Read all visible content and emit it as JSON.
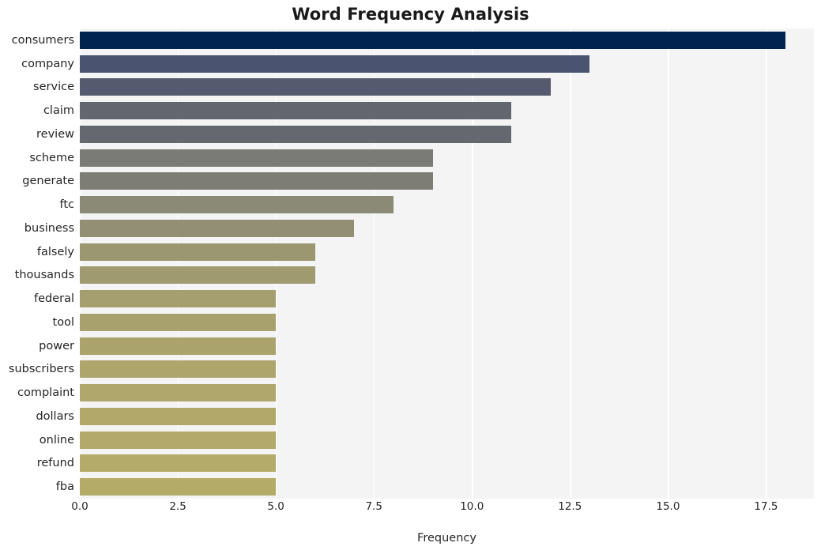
{
  "chart_data": {
    "type": "bar",
    "orientation": "horizontal",
    "title": "Word Frequency Analysis",
    "xlabel": "Frequency",
    "ylabel": "",
    "categories": [
      "consumers",
      "company",
      "service",
      "claim",
      "review",
      "scheme",
      "generate",
      "ftc",
      "business",
      "falsely",
      "thousands",
      "federal",
      "tool",
      "power",
      "subscribers",
      "complaint",
      "dollars",
      "online",
      "refund",
      "fba"
    ],
    "values": [
      18,
      13,
      12,
      11,
      11,
      9,
      9,
      8,
      7,
      6,
      6,
      5,
      5,
      5,
      5,
      5,
      5,
      5,
      5,
      5
    ],
    "bar_colors": [
      "#00234f",
      "#4a5370",
      "#565a6e",
      "#63656f",
      "#666870",
      "#7a7b77",
      "#7d7d76",
      "#8a8a77",
      "#928f74",
      "#9b9771",
      "#9f9a70",
      "#a59e6e",
      "#a8a16d",
      "#aaa36c",
      "#ada56b",
      "#afa76b",
      "#b1a86a",
      "#b2a96a",
      "#b4aa69",
      "#b5ab69"
    ],
    "xlim": [
      0,
      18.72
    ],
    "ylim_count": 20,
    "xticks": [
      0,
      2.5,
      5,
      7.5,
      10,
      12.5,
      15,
      17.5
    ],
    "xtick_labels": [
      "0.0",
      "2.5",
      "5.0",
      "7.5",
      "10.0",
      "12.5",
      "15.0",
      "17.5"
    ],
    "grid": true,
    "grid_axis": "x",
    "grid_color": "#ffffff",
    "plot_background": "#f4f4f5",
    "figure_background": "#ffffff",
    "legend": null
  }
}
